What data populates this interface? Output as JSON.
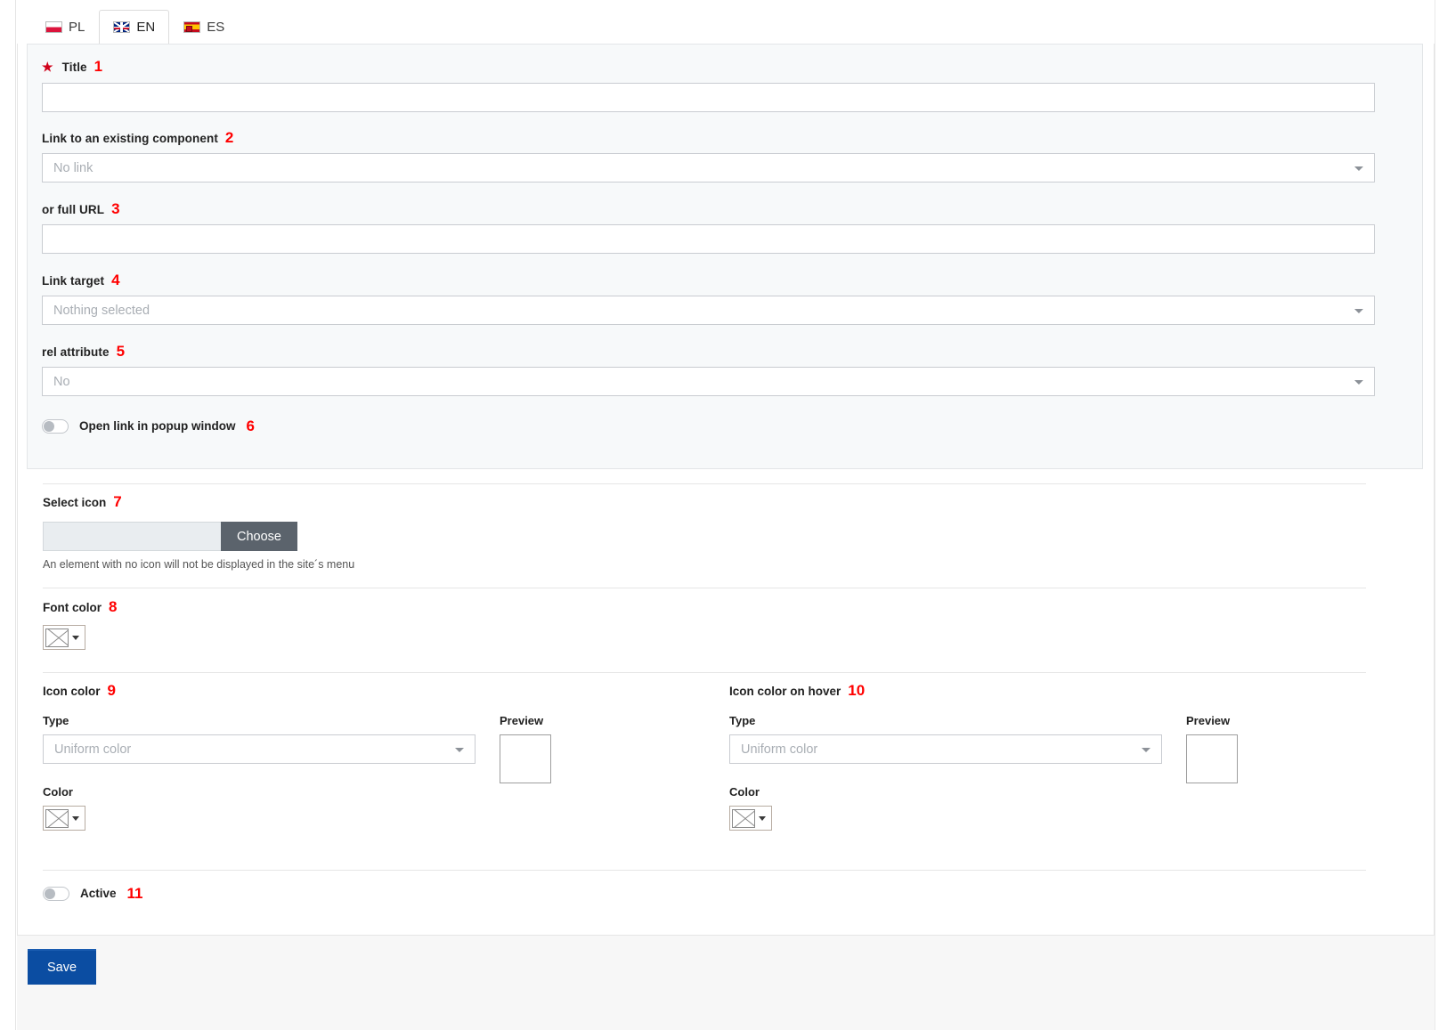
{
  "tabs": [
    {
      "label": "PL",
      "flag": "flag-poland-icon",
      "active": false
    },
    {
      "label": "EN",
      "flag": "flag-uk-icon",
      "active": true
    },
    {
      "label": "ES",
      "flag": "flag-spain-icon",
      "active": false
    }
  ],
  "form": {
    "title": {
      "label": "Title",
      "marker": "1",
      "required": true,
      "value": "",
      "placeholder": ""
    },
    "link_component": {
      "label": "Link to an existing component",
      "marker": "2",
      "value": "No link"
    },
    "full_url": {
      "label": "or full URL",
      "marker": "3",
      "value": "",
      "placeholder": ""
    },
    "link_target": {
      "label": "Link target",
      "marker": "4",
      "value": "Nothing selected"
    },
    "rel_attribute": {
      "label": "rel attribute",
      "marker": "5",
      "value": "No"
    },
    "popup_toggle": {
      "label": "Open link in popup window",
      "marker": "6",
      "checked": false
    }
  },
  "select_icon": {
    "label": "Select icon",
    "marker": "7",
    "value": "",
    "choose_label": "Choose",
    "hint": "An element with no icon will not be displayed in the site´s menu"
  },
  "font_color": {
    "label": "Font color",
    "marker": "8",
    "swatch": "no-color-swatch"
  },
  "icon_color": {
    "label": "Icon color",
    "marker": "9",
    "type_label": "Type",
    "type_value": "Uniform color",
    "preview_label": "Preview",
    "color_label": "Color",
    "swatch": "no-color-swatch"
  },
  "icon_color_hover": {
    "label": "Icon color on hover",
    "marker": "10",
    "type_label": "Type",
    "type_value": "Uniform color",
    "preview_label": "Preview",
    "color_label": "Color",
    "swatch": "no-color-swatch"
  },
  "active_toggle": {
    "label": "Active",
    "marker": "11",
    "checked": false
  },
  "footer": {
    "save_label": "Save"
  },
  "colors": {
    "accent": "#0b4da2",
    "marker_red": "#ff0000",
    "required_red": "#d0021b",
    "fieldset_bg": "#f7f9fa",
    "choose_btn": "#5b636c"
  }
}
